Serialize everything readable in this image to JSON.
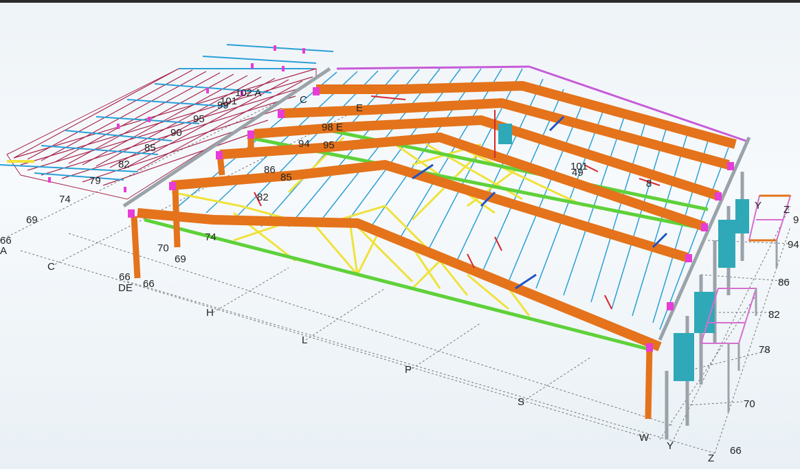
{
  "viewport": {
    "background": "#eef3f7",
    "colors": {
      "rafter": "#e4731b",
      "purlin": "#2a9fd6",
      "brace_yellow": "#f0e23a",
      "tie_green": "#5fd13a",
      "bracing_red": "#d8262b",
      "connector_magenta": "#e83cd6",
      "column_grey": "#9aa3aa",
      "panel_cyan": "#2fa9b8",
      "roof_edge_purple": "#c75bd8",
      "plan_maroon": "#a8244a"
    }
  },
  "labels": {
    "grid_numbers_left": [
      "74",
      "69",
      "66",
      "70",
      "69",
      "66",
      "66"
    ],
    "grid_numbers_right": [
      "9",
      "94",
      "86",
      "82",
      "78",
      "70",
      "66"
    ],
    "grid_letters_bottom": [
      "A",
      "C",
      "DE",
      "H",
      "L",
      "P",
      "S",
      "W",
      "Y",
      "Z"
    ],
    "grid_letters_right_top": [
      "Y",
      "Z"
    ],
    "plan_numbers": [
      "102 A",
      "101",
      "99",
      "95",
      "90",
      "85",
      "82",
      "79"
    ],
    "inner_numbers": [
      "C",
      "E",
      "98 E",
      "94",
      "95",
      "86",
      "85",
      "82",
      "101",
      "49",
      "8",
      "74"
    ]
  }
}
